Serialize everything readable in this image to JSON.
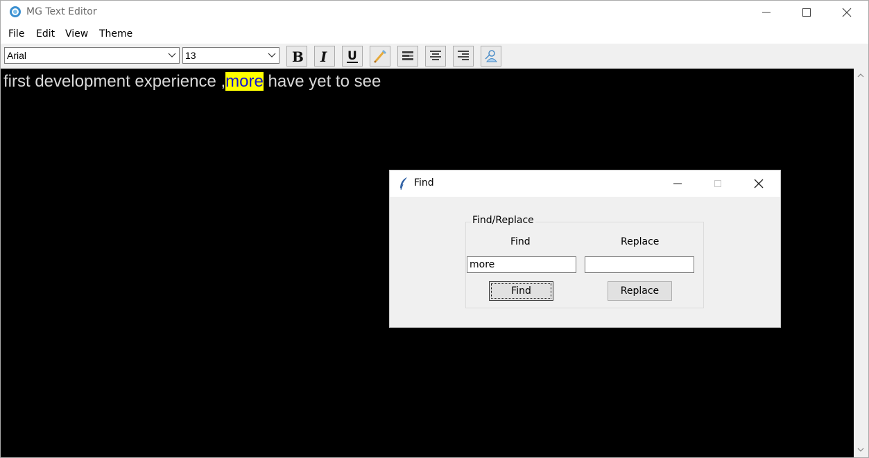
{
  "window": {
    "title": "MG Text Editor"
  },
  "menu": [
    "File",
    "Edit",
    "View",
    "Theme"
  ],
  "toolbar": {
    "font_family": "Arial",
    "font_size": "13",
    "buttons": [
      "bold-icon",
      "italic-icon",
      "underline-icon",
      "color-picker-icon",
      "align-left-icon",
      "align-center-icon",
      "align-right-icon",
      "clear-format-icon"
    ]
  },
  "editor": {
    "text_before": "first development experience ,",
    "text_highlight": "more",
    "text_after": " have yet to see",
    "background": "#000000",
    "text_color": "#d8d8d8",
    "highlight_bg": "#ffff00",
    "highlight_fg": "#1414d2"
  },
  "find_dialog": {
    "title": "Find",
    "group_label": "Find/Replace",
    "find_label": "Find",
    "replace_label": "Replace",
    "find_value": "more",
    "replace_value": "",
    "find_button": "Find",
    "replace_button": "Replace"
  }
}
